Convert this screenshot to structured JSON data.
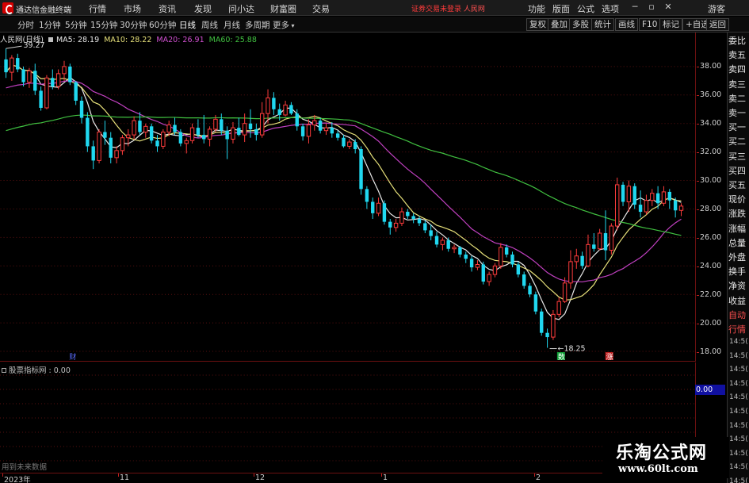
{
  "app": {
    "title": "通达信金融终端",
    "menu": [
      "行情",
      "市场",
      "资讯",
      "发现",
      "问小达",
      "财富圈",
      "交易"
    ],
    "notice": "证券交易未登录",
    "stock_name_top": "人民网",
    "top_buttons": [
      "功能",
      "版面",
      "公式",
      "选项"
    ],
    "guest": "游客"
  },
  "toolbar": {
    "periods": [
      "分时",
      "1分钟",
      "5分钟",
      "15分钟",
      "30分钟",
      "60分钟",
      "日线",
      "周线",
      "月线",
      "多周期",
      "更多"
    ],
    "active_period": "日线",
    "buttons": [
      "复权",
      "叠加",
      "多股",
      "统计",
      "画线",
      "F10",
      "标记",
      "+自选",
      "返回"
    ]
  },
  "main_legend": {
    "title": "人民网(日线)",
    "ma5": "MA5: 28.19",
    "ma10": "MA10: 28.22",
    "ma20": "MA20: 26.91",
    "ma60": "MA60: 25.88"
  },
  "colors": {
    "up": "#ff3c3c",
    "down": "#20d8f0",
    "ma5": "#e8e8e8",
    "ma10": "#e6e07a",
    "ma20": "#c040c0",
    "ma60": "#40c040",
    "frame": "#6a1010",
    "badge_red": "#c02020",
    "badge_green": "#12a038"
  },
  "price_axis": [
    "38.00",
    "36.00",
    "34.00",
    "32.00",
    "30.00",
    "28.00",
    "26.00",
    "24.00",
    "22.00",
    "20.00",
    "18.00"
  ],
  "annotations": {
    "high": "39.27",
    "low": "18.25",
    "badge_cai": "财",
    "badge_shu": "数",
    "badge_zhang": "涨"
  },
  "side_panel": {
    "items": [
      "委比",
      "卖五",
      "卖四",
      "卖三",
      "卖二",
      "卖一",
      "买一",
      "买二",
      "买三",
      "买四",
      "买五",
      "现价",
      "涨跌",
      "涨幅",
      "总量",
      "外盘",
      "换手",
      "净资",
      "收益",
      "自动",
      "行情"
    ],
    "times": [
      "14:5(",
      "14:5(",
      "14:5(",
      "14:5(",
      "14:5(",
      "14:5(",
      "14:5(",
      "14:5(",
      "14:5(",
      "14:5(",
      "14:5("
    ]
  },
  "indicator": {
    "legend": "股票指标网 : 0.00",
    "value": "0.00",
    "future_note": "用到未来数据"
  },
  "time_axis": {
    "labels": [
      "2023年",
      "11",
      "12",
      "1",
      "2"
    ]
  },
  "watermark": {
    "title": "乐淘公式网",
    "url": "www.60lt.com"
  },
  "chart_data": {
    "type": "candlestick",
    "title": "人民网(日线)",
    "ylim": [
      17.5,
      40
    ],
    "y_ticks": [
      18,
      20,
      22,
      24,
      26,
      28,
      30,
      32,
      34,
      36,
      38
    ],
    "candles": [
      [
        38.5,
        39.27,
        37.2,
        37.6
      ],
      [
        37.6,
        38.8,
        37.0,
        38.6
      ],
      [
        38.6,
        38.9,
        37.6,
        37.8
      ],
      [
        37.8,
        38.0,
        36.6,
        36.9
      ],
      [
        36.9,
        37.9,
        36.5,
        37.7
      ],
      [
        37.7,
        38.2,
        36.0,
        36.3
      ],
      [
        36.3,
        36.6,
        34.9,
        35.1
      ],
      [
        35.1,
        37.4,
        35.0,
        37.2
      ],
      [
        37.2,
        37.8,
        36.4,
        36.6
      ],
      [
        36.6,
        37.8,
        36.4,
        37.5
      ],
      [
        37.5,
        38.4,
        37.0,
        38.0
      ],
      [
        38.0,
        38.2,
        36.7,
        36.9
      ],
      [
        36.9,
        37.0,
        35.3,
        35.6
      ],
      [
        35.6,
        35.9,
        34.0,
        34.4
      ],
      [
        34.4,
        34.8,
        32.0,
        32.4
      ],
      [
        32.4,
        32.8,
        30.8,
        31.4
      ],
      [
        31.4,
        33.6,
        31.2,
        33.4
      ],
      [
        33.4,
        34.2,
        32.5,
        33.0
      ],
      [
        33.0,
        33.4,
        31.2,
        31.6
      ],
      [
        31.6,
        32.4,
        31.2,
        32.1
      ],
      [
        32.1,
        33.2,
        31.8,
        33.0
      ],
      [
        33.0,
        33.6,
        32.4,
        33.2
      ],
      [
        33.2,
        34.5,
        32.9,
        34.2
      ],
      [
        34.2,
        34.8,
        33.2,
        33.4
      ],
      [
        33.4,
        34.0,
        33.0,
        33.8
      ],
      [
        33.8,
        34.0,
        32.6,
        32.8
      ],
      [
        32.8,
        33.2,
        32.0,
        32.4
      ],
      [
        32.4,
        33.6,
        32.2,
        33.4
      ],
      [
        33.4,
        34.2,
        33.1,
        33.9
      ],
      [
        33.9,
        34.4,
        33.2,
        33.4
      ],
      [
        33.4,
        33.6,
        32.4,
        32.6
      ],
      [
        32.6,
        33.0,
        31.9,
        32.8
      ],
      [
        32.8,
        34.0,
        32.6,
        33.7
      ],
      [
        33.7,
        34.3,
        33.0,
        33.2
      ],
      [
        33.2,
        34.6,
        32.6,
        32.9
      ],
      [
        32.9,
        33.8,
        32.4,
        33.6
      ],
      [
        33.6,
        34.6,
        33.4,
        34.3
      ],
      [
        34.3,
        34.7,
        33.2,
        33.5
      ],
      [
        33.5,
        33.8,
        31.5,
        32.9
      ],
      [
        32.9,
        34.1,
        32.6,
        33.7
      ],
      [
        33.7,
        34.4,
        33.1,
        33.2
      ],
      [
        33.2,
        34.7,
        32.7,
        34.0
      ],
      [
        34.0,
        35.0,
        33.0,
        33.6
      ],
      [
        33.6,
        34.0,
        32.8,
        33.2
      ],
      [
        33.2,
        35.5,
        33.0,
        34.7
      ],
      [
        34.7,
        36.4,
        34.0,
        35.8
      ],
      [
        35.8,
        36.2,
        34.6,
        35.0
      ],
      [
        35.0,
        35.4,
        34.2,
        34.6
      ],
      [
        34.6,
        35.6,
        34.5,
        35.3
      ],
      [
        35.3,
        35.5,
        34.6,
        34.7
      ],
      [
        34.7,
        35.0,
        33.5,
        33.8
      ],
      [
        33.8,
        34.0,
        32.8,
        33.1
      ],
      [
        33.1,
        34.3,
        32.6,
        33.9
      ],
      [
        33.9,
        34.6,
        33.5,
        34.2
      ],
      [
        34.2,
        34.4,
        33.3,
        33.5
      ],
      [
        33.5,
        34.0,
        33.2,
        33.7
      ],
      [
        33.7,
        34.1,
        33.0,
        33.3
      ],
      [
        33.3,
        33.5,
        32.8,
        33.0
      ],
      [
        33.0,
        33.2,
        32.3,
        32.4
      ],
      [
        32.4,
        32.9,
        32.2,
        32.7
      ],
      [
        32.7,
        32.9,
        31.9,
        32.2
      ],
      [
        32.2,
        32.4,
        29.0,
        29.4
      ],
      [
        29.4,
        29.6,
        28.0,
        28.5
      ],
      [
        28.5,
        28.8,
        27.3,
        27.7
      ],
      [
        27.7,
        28.8,
        27.5,
        28.4
      ],
      [
        28.4,
        28.6,
        26.9,
        27.1
      ],
      [
        27.1,
        27.3,
        26.2,
        26.7
      ],
      [
        26.7,
        27.3,
        26.4,
        27.0
      ],
      [
        27.0,
        28.1,
        26.8,
        27.8
      ],
      [
        27.8,
        28.0,
        27.3,
        27.5
      ],
      [
        27.5,
        27.7,
        27.0,
        27.3
      ],
      [
        27.3,
        27.5,
        26.8,
        27.0
      ],
      [
        27.0,
        27.2,
        26.3,
        26.5
      ],
      [
        26.5,
        26.9,
        25.8,
        26.1
      ],
      [
        26.1,
        26.4,
        25.3,
        25.5
      ],
      [
        25.5,
        26.0,
        25.1,
        25.8
      ],
      [
        25.8,
        26.0,
        25.0,
        25.2
      ],
      [
        25.2,
        25.5,
        24.9,
        25.3
      ],
      [
        25.3,
        25.4,
        24.6,
        24.8
      ],
      [
        24.8,
        25.0,
        24.2,
        24.5
      ],
      [
        24.5,
        24.7,
        23.6,
        23.9
      ],
      [
        23.9,
        24.4,
        23.7,
        24.1
      ],
      [
        24.1,
        24.3,
        22.7,
        22.9
      ],
      [
        22.9,
        23.6,
        22.6,
        23.4
      ],
      [
        23.4,
        24.2,
        23.2,
        24.0
      ],
      [
        24.0,
        25.6,
        23.8,
        25.3
      ],
      [
        25.3,
        25.5,
        24.6,
        24.8
      ],
      [
        24.8,
        25.0,
        23.9,
        24.1
      ],
      [
        24.1,
        24.3,
        23.2,
        23.4
      ],
      [
        23.4,
        23.6,
        22.4,
        22.6
      ],
      [
        22.6,
        22.8,
        21.8,
        22.0
      ],
      [
        22.0,
        22.2,
        20.6,
        20.8
      ],
      [
        20.8,
        21.0,
        19.1,
        19.3
      ],
      [
        19.3,
        19.6,
        18.25,
        19.0
      ],
      [
        19.0,
        20.9,
        18.8,
        20.6
      ],
      [
        20.6,
        21.8,
        20.4,
        21.5
      ],
      [
        21.5,
        23.2,
        21.4,
        22.8
      ],
      [
        22.8,
        25.1,
        22.4,
        24.3
      ],
      [
        24.3,
        25.2,
        23.8,
        24.7
      ],
      [
        24.7,
        25.0,
        23.8,
        24.0
      ],
      [
        24.0,
        26.2,
        23.9,
        25.5
      ],
      [
        25.5,
        26.3,
        25.0,
        25.2
      ],
      [
        25.2,
        26.6,
        25.1,
        26.3
      ],
      [
        26.3,
        27.9,
        24.4,
        25.1
      ],
      [
        25.1,
        27.0,
        24.8,
        26.8
      ],
      [
        26.8,
        30.2,
        26.5,
        29.7
      ],
      [
        29.7,
        29.9,
        28.2,
        28.5
      ],
      [
        28.5,
        30.0,
        27.8,
        29.6
      ],
      [
        29.6,
        29.8,
        28.0,
        28.3
      ],
      [
        28.3,
        29.3,
        27.4,
        27.8
      ],
      [
        27.8,
        29.0,
        27.6,
        28.6
      ],
      [
        28.6,
        29.4,
        28.2,
        29.1
      ],
      [
        29.1,
        29.6,
        28.0,
        28.4
      ],
      [
        28.4,
        29.6,
        28.2,
        29.2
      ],
      [
        29.2,
        29.4,
        28.0,
        28.6
      ],
      [
        28.6,
        28.8,
        27.4,
        27.9
      ],
      [
        27.9,
        28.4,
        27.5,
        28.2
      ]
    ],
    "ma_labels": [
      "MA5",
      "MA10",
      "MA20",
      "MA60"
    ],
    "ma_last": [
      28.19,
      28.22,
      26.91,
      25.88
    ],
    "high_label": 39.27,
    "low_label": 18.25
  }
}
